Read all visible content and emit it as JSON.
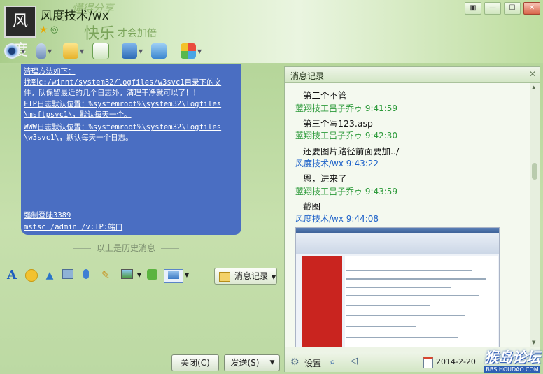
{
  "window": {
    "title": "风度技术/wx",
    "avatar_text": "风度",
    "slogan_top": "懂得分享",
    "slogan_main": "快乐",
    "slogan_sub": "才会加倍",
    "controls": [
      "▣",
      "—",
      "☐",
      "✕"
    ]
  },
  "chat": {
    "lines": [
      "    清理方法如下：",
      "    找到c:/winnt/system32/logfiles/w3svc1目录下的文",
      "件，队保留最近的几个日志外，清理干净就可以了！！",
      "    FTP日志默认位置：%systemroot%\\system32\\logfiles",
      "\\msftpsvc1\\，默认每天一个。",
      "    WWW日志默认位置：%systemroot%\\system32\\logfiles",
      "\\w3svc1\\，默认每天一个日志。",
      "强制登陆3389",
      "mstsc /admin /v:IP:端口"
    ],
    "history_divider": "以上是历史消息"
  },
  "format_toolbar": {
    "history_button_label": "消息记录"
  },
  "buttons": {
    "close_label": "关闭(C)",
    "send_label": "发送(S)"
  },
  "history": {
    "title": "消息记录",
    "entries": [
      {
        "type": "msg",
        "text": "第二个不管"
      },
      {
        "type": "name",
        "color": "green",
        "text": "蓝翔技工吕子乔ゥ 9:41:59"
      },
      {
        "type": "msg",
        "text": "第三个写123.asp"
      },
      {
        "type": "name",
        "color": "green",
        "text": "蓝翔技工吕子乔ゥ 9:42:30"
      },
      {
        "type": "msg",
        "text": "还要图片路径前面要加../"
      },
      {
        "type": "name",
        "color": "blue",
        "text": "风度技术/wx 9:43:22"
      },
      {
        "type": "msg",
        "text": "恩，进来了"
      },
      {
        "type": "name",
        "color": "green",
        "text": "蓝翔技工吕子乔ゥ 9:43:59"
      },
      {
        "type": "msg",
        "text": "截图"
      },
      {
        "type": "name",
        "color": "blue",
        "text": "风度技术/wx 9:44:08"
      }
    ],
    "settings_label": "设置",
    "date": "2014-2-20"
  },
  "watermark": {
    "main": "猴岛论坛",
    "sub": "BBS.HOUDAO.COM"
  }
}
